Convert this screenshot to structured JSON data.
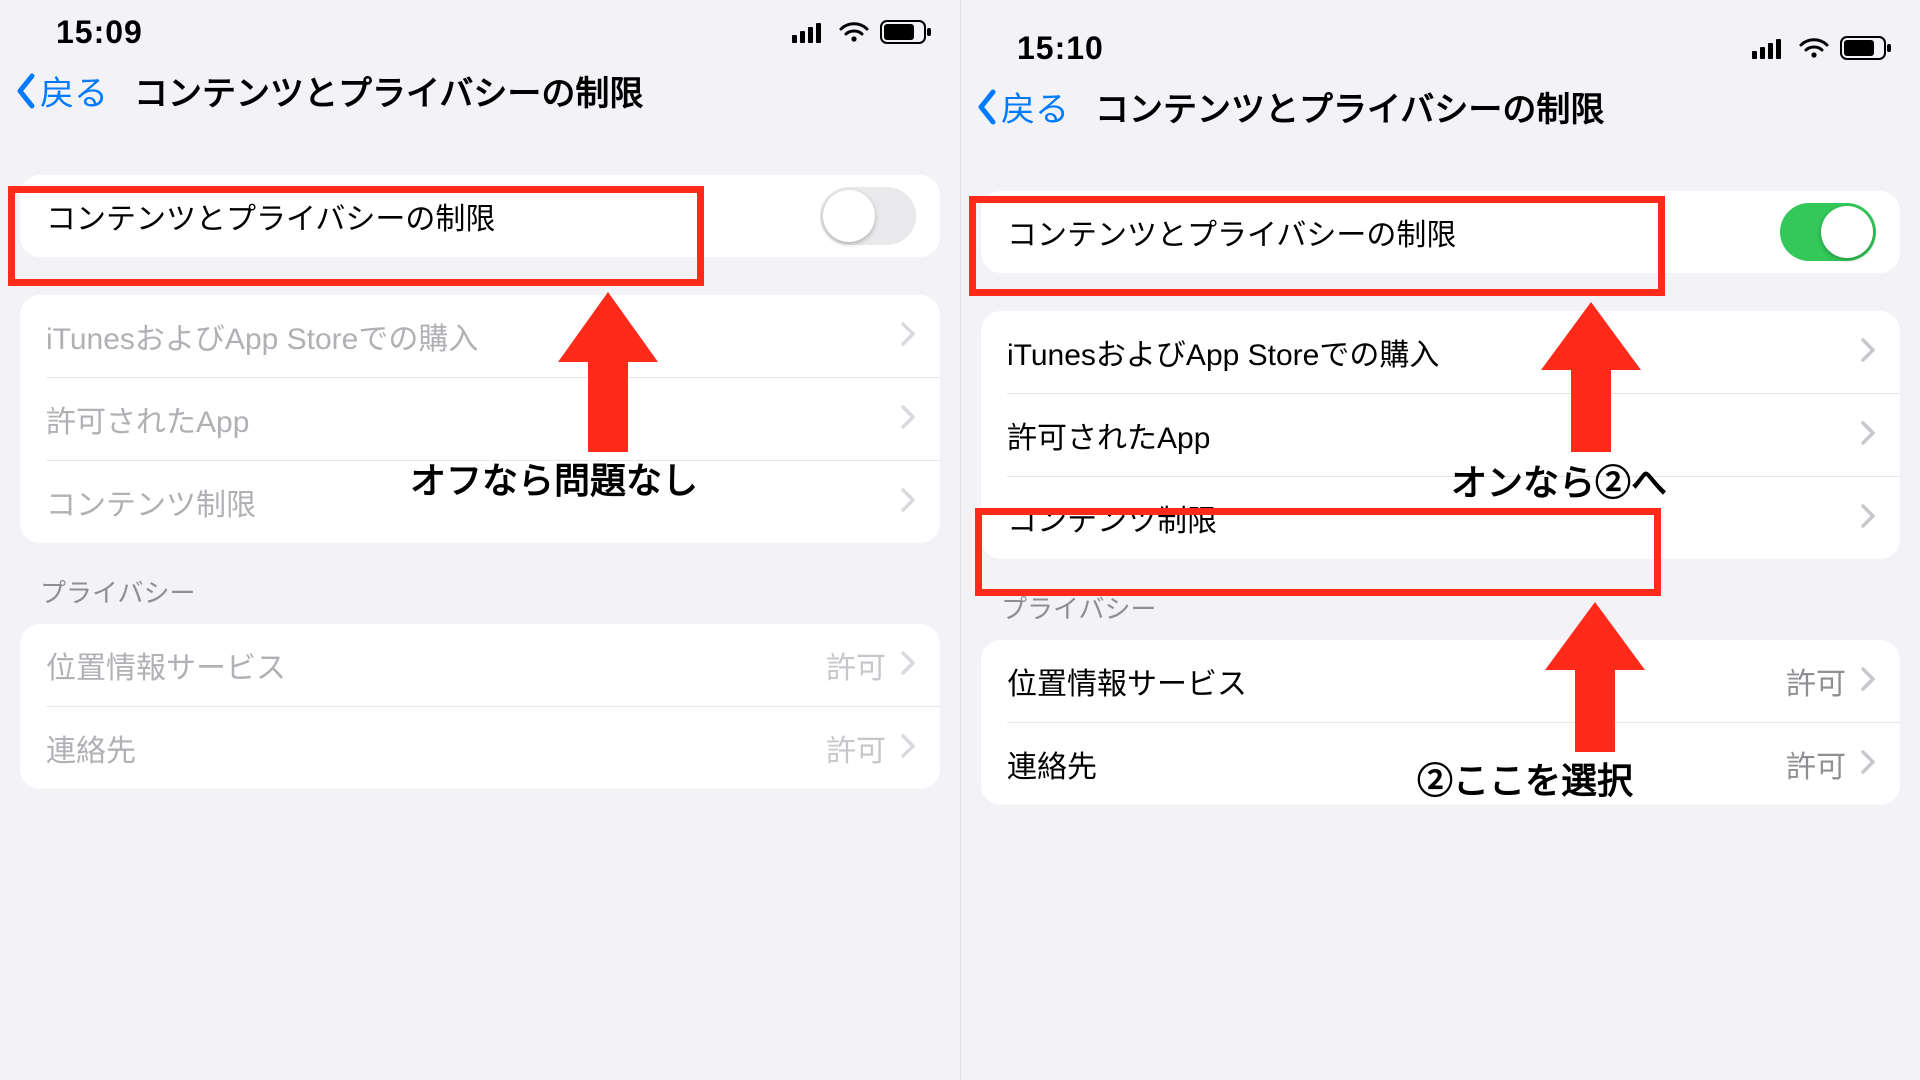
{
  "left": {
    "status": {
      "time": "15:09"
    },
    "nav": {
      "back": "戻る",
      "title": "コンテンツとプライバシーの制限"
    },
    "toggle_row": {
      "label": "コンテンツとプライバシーの制限",
      "on": false
    },
    "group1": [
      {
        "label": "iTunesおよびApp Storeでの購入"
      },
      {
        "label": "許可されたApp"
      },
      {
        "label": "コンテンツ制限"
      }
    ],
    "privacy_header": "プライバシー",
    "group2": [
      {
        "label": "位置情報サービス",
        "value": "許可"
      },
      {
        "label": "連絡先",
        "value": "許可"
      }
    ],
    "annotation1": "オフなら問題なし"
  },
  "right": {
    "status": {
      "time": "15:10"
    },
    "nav": {
      "back": "戻る",
      "title": "コンテンツとプライバシーの制限"
    },
    "toggle_row": {
      "label": "コンテンツとプライバシーの制限",
      "on": true
    },
    "group1": [
      {
        "label": "iTunesおよびApp Storeでの購入"
      },
      {
        "label": "許可されたApp"
      },
      {
        "label": "コンテンツ制限"
      }
    ],
    "privacy_header": "プライバシー",
    "group2": [
      {
        "label": "位置情報サービス",
        "value": "許可"
      },
      {
        "label": "連絡先",
        "value": "許可"
      }
    ],
    "annotation1": "オンなら②へ",
    "annotation2": "②ここを選択"
  }
}
